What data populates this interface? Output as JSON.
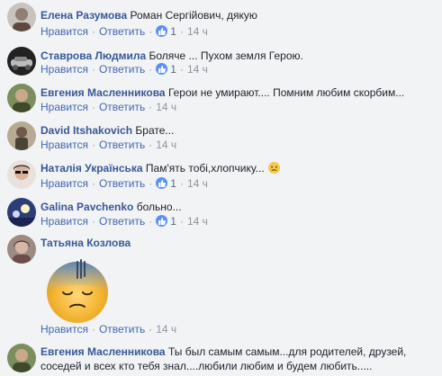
{
  "actions": {
    "like": "Нравится",
    "reply": "Ответить"
  },
  "comments": [
    {
      "name": "Елена Разумова",
      "text": "Роман Сергійович, дякую",
      "likes": "1",
      "time": "14 ч"
    },
    {
      "name": "Ставрова Людмила",
      "text": "Боляче ... Пухом земля Герою.",
      "likes": "1",
      "time": "14 ч"
    },
    {
      "name": "Евгения Масленникова",
      "text": "Герои не умирают.... Помним любим скорбим...",
      "time": "14 ч"
    },
    {
      "name": "David Itshakovich",
      "text": "Брате...",
      "time": "14 ч"
    },
    {
      "name": "Наталія Українська",
      "text": "Пам'ять тобі,хлопчику...",
      "likes": "1",
      "time": "14 ч"
    },
    {
      "name": "Galina Pavchenko",
      "text": "больно...",
      "likes": "1",
      "time": "14 ч"
    },
    {
      "name": "Татьяна Козлова",
      "time": "14 ч"
    },
    {
      "name": "Евгения Масленникова",
      "text_line1": "Ты был самым самым...для родителей, друзей,",
      "text_line2": "соседей и всех кто тебя знал....любили любим и будем любить....."
    }
  ],
  "colors": {
    "name": "#385898",
    "action": "#4267b2",
    "like": "#5890ff",
    "background": "#f2f3f5"
  },
  "icons": {
    "like": "thumbs-up-icon",
    "emoji": "sad-face-icon",
    "sticker": "sad-sweating-sticker"
  }
}
